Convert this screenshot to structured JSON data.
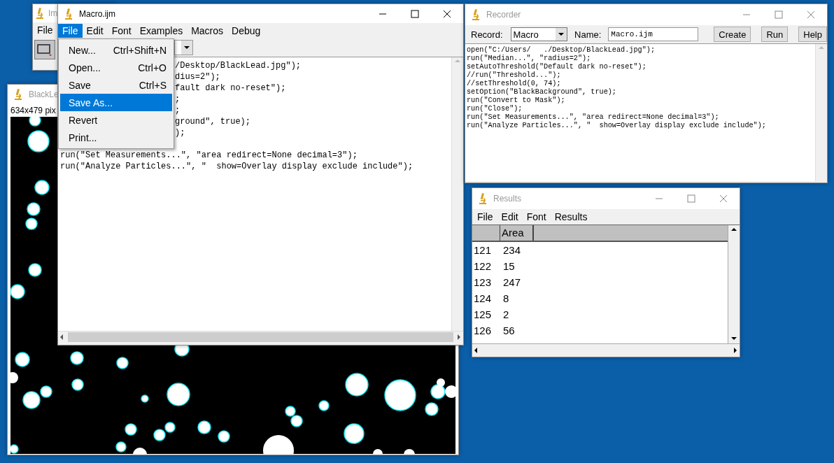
{
  "main_window": {
    "title": "Im",
    "active": false,
    "menu": [
      "File"
    ]
  },
  "image_window": {
    "title": "BlackLe",
    "active": false,
    "subtitle": "634x479 pix"
  },
  "macro_window": {
    "title": "Macro.ijm",
    "active": true,
    "menu": [
      {
        "label": "File",
        "selected": true
      },
      {
        "label": "Edit",
        "selected": false
      },
      {
        "label": "Font",
        "selected": false
      },
      {
        "label": "Examples",
        "selected": false
      },
      {
        "label": "Macros",
        "selected": false
      },
      {
        "label": "Debug",
        "selected": false
      }
    ],
    "lines": [
      {
        "text": "/Desktop/BlackLead.jpg\");",
        "partial": true
      },
      {
        "text": "dius=2\");",
        "partial": true
      },
      {
        "text": "fault dark no-reset\");",
        "partial": true
      },
      {
        "text": ";",
        "partial": true
      },
      {
        "text": ";",
        "partial": true
      },
      {
        "text": "ground\", true);",
        "partial": true
      },
      {
        "text": ");",
        "partial": true
      },
      {
        "text": "run(\"Set Measurements...\", \"area redirect=None decimal=3\");",
        "partial": false
      },
      {
        "text": "run(\"Analyze Particles...\", \"  show=Overlay display exclude include\");",
        "partial": false
      }
    ]
  },
  "file_menu": {
    "items": [
      {
        "label": "New...",
        "shortcut": "Ctrl+Shift+N",
        "selected": false
      },
      {
        "label": "Open...",
        "shortcut": "Ctrl+O",
        "selected": false
      },
      {
        "label": "Save",
        "shortcut": "Ctrl+S",
        "selected": false
      },
      {
        "label": "Save As...",
        "selected": true
      },
      {
        "label": "Revert",
        "selected": false
      },
      {
        "label": "Print...",
        "selected": false
      }
    ]
  },
  "recorder": {
    "title": "Recorder",
    "active": false,
    "record_label": "Record:",
    "record_value": "Macro",
    "name_label": "Name:",
    "name_value": "Macro.ijm",
    "buttons": [
      "Create",
      "Run",
      "Help"
    ],
    "lines": [
      "open(\"C:/Users/   ./Desktop/BlackLead.jpg\");",
      "run(\"Median...\", \"radius=2\");",
      "setAutoThreshold(\"Default dark no-reset\");",
      "//run(\"Threshold...\");",
      "//setThreshold(0, 74);",
      "setOption(\"BlackBackground\", true);",
      "run(\"Convert to Mask\");",
      "run(\"Close\");",
      "run(\"Set Measurements...\", \"area redirect=None decimal=3\");",
      "run(\"Analyze Particles...\", \"  show=Overlay display exclude include\");"
    ]
  },
  "results": {
    "title": "Results",
    "active": false,
    "menu": [
      "File",
      "Edit",
      "Font",
      "Results"
    ],
    "columns": [
      "",
      "Area"
    ],
    "rows": [
      [
        "121",
        "234"
      ],
      [
        "122",
        "15"
      ],
      [
        "123",
        "247"
      ],
      [
        "124",
        "8"
      ],
      [
        "125",
        "2"
      ],
      [
        "126",
        "56"
      ]
    ]
  }
}
